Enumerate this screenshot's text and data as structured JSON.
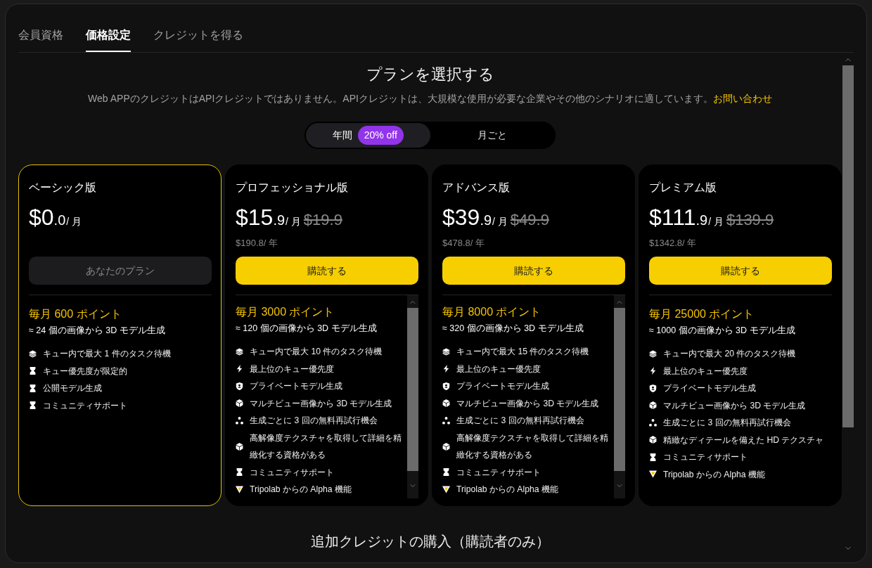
{
  "tabs": [
    {
      "label": "会員資格",
      "selected": false
    },
    {
      "label": "価格設定",
      "selected": true
    },
    {
      "label": "クレジットを得る",
      "selected": false
    }
  ],
  "header": {
    "title": "プランを選択する",
    "notice": "Web APPのクレジットはAPIクレジットではありません。APIクレジットは、大規模な使用が必要な企業やその他のシナリオに適しています。",
    "contact_link": "お問い合わせ"
  },
  "billing_toggle": [
    {
      "label": "年間",
      "badge": "20% off",
      "selected": true
    },
    {
      "label": "月ごと",
      "selected": false
    }
  ],
  "plans": [
    {
      "name": "ベーシック版",
      "current": true,
      "price": "$0.0",
      "period": "/ 月",
      "button": "あなたのプラン",
      "points": "毎月 600 ポイント",
      "estimate": "≈ 24 個の画像から 3D モデル生成",
      "scrollable": false,
      "features": [
        {
          "kind": "layers",
          "text": "キュー内で最大 1 件のタスク待機"
        },
        {
          "kind": "hourglass",
          "text": "キュー優先度が限定的"
        },
        {
          "kind": "hourglass",
          "text": "公開モデル生成"
        },
        {
          "kind": "hourglass",
          "text": "コミュニティサポート"
        }
      ]
    },
    {
      "name": "プロフェッショナル版",
      "current": false,
      "price": "$15.9",
      "period": "/ 月",
      "original_price": "$19.9",
      "yearly": "$190.8/ 年",
      "button": "購読する",
      "points": "毎月 3000 ポイント",
      "estimate": "≈ 120 個の画像から 3D モデル生成",
      "scrollable": true,
      "features": [
        {
          "kind": "layers",
          "text": "キュー内で最大 10 件のタスク待機"
        },
        {
          "kind": "bolt",
          "text": "最上位のキュー優先度"
        },
        {
          "kind": "shield",
          "text": "プライベートモデル生成"
        },
        {
          "kind": "cube",
          "text": "マルチビュー画像から 3D モデル生成"
        },
        {
          "kind": "dots",
          "text": "生成ごとに 3 回の無料再試行機会"
        },
        {
          "kind": "cube",
          "text": "高解像度テクスチャを取得して詳細を精緻化する資格がある"
        },
        {
          "kind": "hourglass",
          "text": "コミュニティサポート"
        },
        {
          "kind": "logo",
          "text": "Tripolab からの Alpha 機能"
        }
      ]
    },
    {
      "name": "アドバンス版",
      "current": false,
      "price": "$39.9",
      "period": "/ 月",
      "original_price": "$49.9",
      "yearly": "$478.8/ 年",
      "button": "購読する",
      "points": "毎月 8000 ポイント",
      "estimate": "≈ 320 個の画像から 3D モデル生成",
      "scrollable": true,
      "features": [
        {
          "kind": "layers",
          "text": "キュー内で最大 15 件のタスク待機"
        },
        {
          "kind": "bolt",
          "text": "最上位のキュー優先度"
        },
        {
          "kind": "shield",
          "text": "プライベートモデル生成"
        },
        {
          "kind": "cube",
          "text": "マルチビュー画像から 3D モデル生成"
        },
        {
          "kind": "dots",
          "text": "生成ごとに 3 回の無料再試行機会"
        },
        {
          "kind": "cube",
          "text": "高解像度テクスチャを取得して詳細を精緻化する資格がある"
        },
        {
          "kind": "hourglass",
          "text": "コミュニティサポート"
        },
        {
          "kind": "logo",
          "text": "Tripolab からの Alpha 機能"
        }
      ]
    },
    {
      "name": "プレミアム版",
      "current": false,
      "price": "$111.9",
      "period": "/ 月",
      "original_price": "$139.9",
      "yearly": "$1342.8/ 年",
      "button": "購読する",
      "points": "毎月 25000 ポイント",
      "estimate": "≈ 1000 個の画像から 3D モデル生成",
      "scrollable": false,
      "features": [
        {
          "kind": "layers",
          "text": "キュー内で最大 20 件のタスク待機"
        },
        {
          "kind": "bolt",
          "text": "最上位のキュー優先度"
        },
        {
          "kind": "shield",
          "text": "プライベートモデル生成"
        },
        {
          "kind": "cube",
          "text": "マルチビュー画像から 3D モデル生成"
        },
        {
          "kind": "dots",
          "text": "生成ごとに 3 回の無料再試行機会"
        },
        {
          "kind": "cube",
          "text": "精緻なディテールを備えた HD テクスチャ"
        },
        {
          "kind": "hourglass",
          "text": "コミュニティサポート"
        },
        {
          "kind": "logo",
          "text": "Tripolab からの Alpha 機能"
        }
      ]
    }
  ],
  "extra_credits": {
    "title": "追加クレジットの購入（購読者のみ）"
  }
}
